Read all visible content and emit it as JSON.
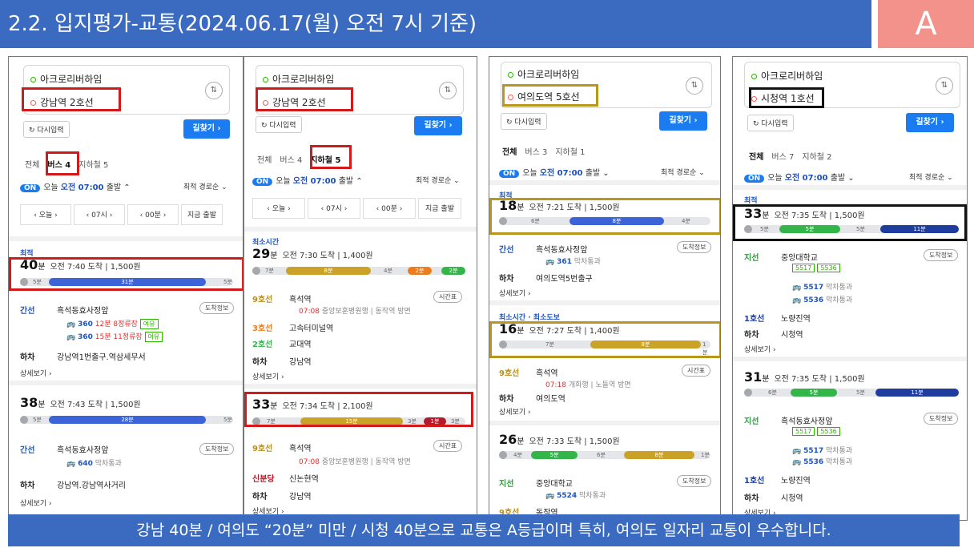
{
  "header": {
    "title": "2.2. 입지평가-교통(2024.06.17(월) 오전 7시 기준)",
    "grade": "A"
  },
  "common": {
    "origin": "아크로리버하임",
    "retry": "다시입력",
    "find": "길찾기 ›",
    "on": "ON",
    "today": "오늘",
    "time": "오전 07:00",
    "depart": "출발",
    "sort": "최적 경로순",
    "walk": "하차",
    "detail": "상세보기 ›",
    "arrival_info": "도착정보",
    "timetable": "시간표",
    "pass": "막차통과"
  },
  "panels": [
    {
      "dest": "강남역 2호선",
      "tabs": [
        "전체",
        "버스 4",
        "지하철 5"
      ],
      "timesel": [
        "‹  오늘  ›",
        "‹  07시  ›",
        "‹  00분  ›",
        "지금 출발"
      ],
      "r1": {
        "label": "최적",
        "min": "40",
        "unit": "분",
        "meta": "오전 7:40 도착  |  1,500원",
        "walk1": "5분",
        "seg": "31분",
        "walk2": "5분"
      },
      "r1steps": {
        "a": "간선",
        "a_val": "흑석동효사정앞",
        "bus1": "360",
        "bus1_t": "12분 8정류장",
        "bus2": "360",
        "bus2_t": "15분 11정류장",
        "badge": "여유",
        "off": "강남역1번출구.역삼세무서"
      },
      "r2": {
        "min": "38",
        "unit": "분",
        "meta": "오전 7:43 도착  |  1,500원",
        "walk1": "5분",
        "seg": "28분",
        "walk2": "5분"
      },
      "r2steps": {
        "a": "간선",
        "a_val": "흑석동효사정앞",
        "bus1": "640",
        "off": "강남역.강남역사거리"
      }
    },
    {
      "dest": "강남역 2호선",
      "tabs": [
        "전체",
        "버스 4",
        "지하철 5"
      ],
      "timesel": [
        "‹  오늘  ›",
        "‹  07시  ›",
        "‹  00분  ›",
        "지금 출발"
      ],
      "r1": {
        "label": "최소시간",
        "min": "29",
        "unit": "분",
        "meta": "오전 7:30 도착  |  1,400원",
        "walk1": "7분",
        "seg": "8분",
        "walk2": "4분",
        "seg2": "2분",
        "seg3": "2분"
      },
      "r1steps": {
        "a": "9호선",
        "a_val": "흑석역",
        "a_sub": "07:08",
        "a_sub2": "중앙보훈병원행 | 동작역 방면",
        "b": "3호선",
        "b_val": "고속터미널역",
        "c": "2호선",
        "c_val": "교대역",
        "off": "강남역"
      },
      "r2": {
        "min": "33",
        "unit": "분",
        "meta": "오전 7:34 도착  |  2,100원",
        "walk1": "7분",
        "seg": "15분",
        "walk2": "3분",
        "seg2": "1분",
        "walk3": "3분"
      },
      "r2steps": {
        "a": "9호선",
        "a_val": "흑석역",
        "a_sub": "07:08",
        "a_sub2": "중앙보훈병원행 | 동작역 방면",
        "b": "신분당",
        "b_val": "신논현역",
        "off": "강남역"
      }
    },
    {
      "dest": "여의도역 5호선",
      "tabs": [
        "전체",
        "버스 3",
        "지하철 1"
      ],
      "r1": {
        "label": "최적",
        "min": "18",
        "unit": "분",
        "meta": "오전 7:21 도착  |  1,500원",
        "walk1": "6분",
        "seg": "8분",
        "walk2": "4분"
      },
      "r1steps": {
        "a": "간선",
        "a_val": "흑석동효사정앞",
        "bus1": "361",
        "off": "여의도역5번출구"
      },
      "r2": {
        "label": "최소시간 · 최소도보",
        "min": "16",
        "unit": "분",
        "meta": "오전 7:27 도착  |  1,400원",
        "walk1": "7분",
        "seg": "8분",
        "walk2": "1분"
      },
      "r2steps": {
        "a": "9호선",
        "a_val": "흑석역",
        "a_sub": "07:18",
        "a_sub2": "개화행 | 노들역 방면",
        "off": "여의도역"
      },
      "r3": {
        "min": "26",
        "unit": "분",
        "meta": "오전 7:33 도착  |  1,500원",
        "walk1": "4분",
        "seg": "5분",
        "walk2": "6분",
        "seg2": "8분",
        "walk3": "1분"
      },
      "r3steps": {
        "a": "지선",
        "a_val": "중앙대학교",
        "bus1": "5524",
        "b": "9호선",
        "b_val": "동작역"
      }
    },
    {
      "dest": "시청역 1호선",
      "tabs": [
        "전체",
        "버스 7",
        "지하철 2"
      ],
      "r1": {
        "label": "최적",
        "min": "33",
        "unit": "분",
        "meta": "오전 7:35 도착  |  1,500원",
        "walk1": "5분",
        "seg": "5분",
        "walk2": "5분",
        "seg2": "11분"
      },
      "r1steps": {
        "a": "지선",
        "a_val": "중앙대학교",
        "tag1": "5517",
        "tag2": "5536",
        "bus1": "5517",
        "bus2": "5536",
        "b": "1호선",
        "b_val": "노량진역",
        "off": "시청역"
      },
      "r2": {
        "min": "31",
        "unit": "분",
        "meta": "오전 7:35 도착  |  1,500원",
        "walk1": "6분",
        "seg": "5분",
        "walk2": "5분",
        "seg2": "11분"
      },
      "r2steps": {
        "a": "지선",
        "a_val": "흑석동효사정앞",
        "tag1": "5517",
        "tag2": "5536",
        "bus1": "5517",
        "bus2": "5536",
        "b": "1호선",
        "b_val": "노량진역",
        "off": "시청역"
      }
    }
  ],
  "footer": "강남 40분 / 여의도 “20분” 미만 / 시청 40분으로 교통은 A등급이며 특히, 여의도 일자리 교통이 우수합니다.",
  "colors": {
    "header": "#3a6bc1",
    "grade": "#f2928a",
    "bus_blue": "#3d63d8",
    "line9": "#c9a227",
    "line2": "#33b54a",
    "line3": "#ef7c1c",
    "sinbundang": "#b31b2a",
    "line1": "#1f3d9e",
    "highlight_red": "#d21a1a",
    "highlight_gold": "#b8981c"
  }
}
